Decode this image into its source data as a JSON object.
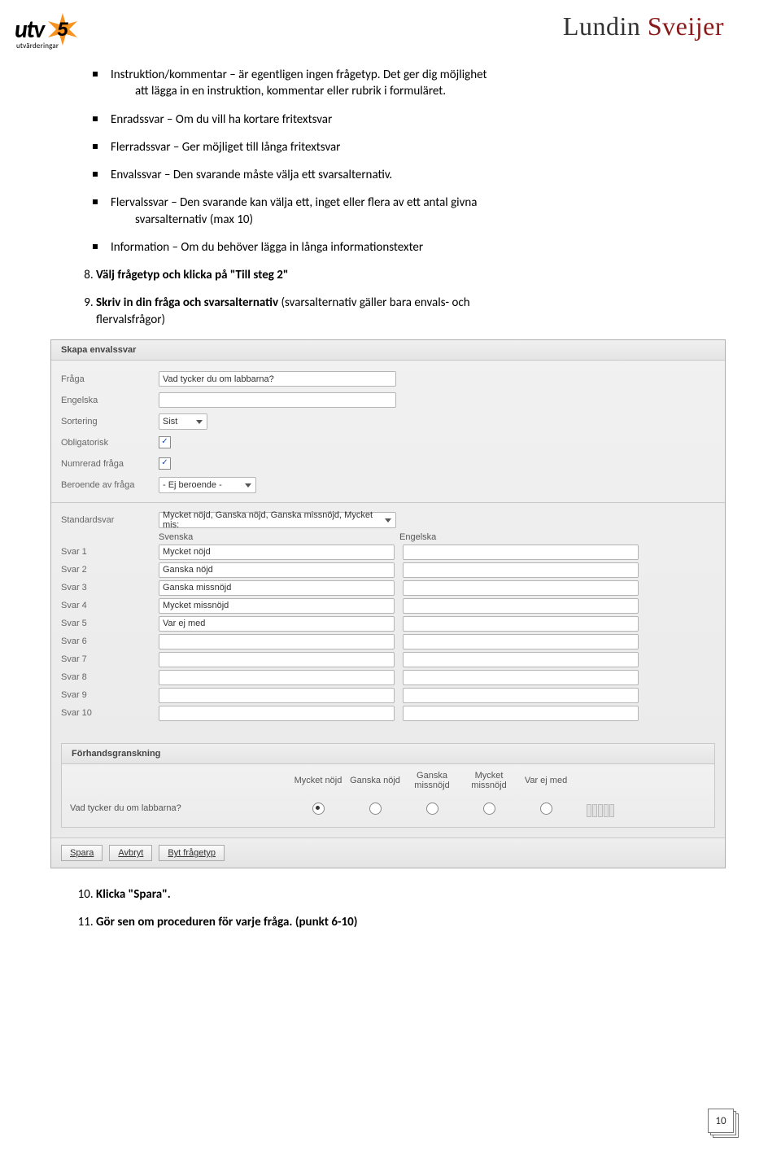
{
  "header": {
    "logo_text": "utv",
    "logo_sub": "utvärderingar",
    "brand_a": "Lundin ",
    "brand_b": "Sveijer"
  },
  "bullets": {
    "b1a": "Instruktion/kommentar – är egentligen ingen frågetyp. Det ger dig möjlighet",
    "b1b": "att lägga in en instruktion, kommentar eller rubrik i formuläret.",
    "b2": "Enradssvar – Om du vill ha kortare fritextsvar",
    "b3": "Flerradssvar – Ger möjliget till långa fritextsvar",
    "b4": "Envalssvar – Den svarande måste välja ett svarsalternativ.",
    "b5a": "Flervalssvar – Den svarande kan välja ett, inget eller flera av ett antal givna",
    "b5b": "svarsalternativ (max 10)",
    "b6": "Information – Om du behöver lägga in långa informationstexter"
  },
  "steps": {
    "s8_a": "Välj frågetyp och klicka på \"Till steg 2\"",
    "s9_a": "Skriv in din fråga och svarsalternativ",
    "s9_b": " (svarsalternativ gäller bara envals- och",
    "s9_c": "flervalsfrågor)",
    "s10_a": "Klicka \"Spara\".",
    "s11_a": "Gör sen om proceduren för varje fråga. (punkt 6-10)"
  },
  "form": {
    "panel_title": "Skapa envalssvar",
    "labels": {
      "fraga": "Fråga",
      "engelska": "Engelska",
      "sortering": "Sortering",
      "obligatorisk": "Obligatorisk",
      "numrerad": "Numrerad fråga",
      "beroende": "Beroende av fråga",
      "standardsvar": "Standardsvar",
      "svenska_col": "Svenska",
      "engelska_col": "Engelska",
      "svar": [
        "Svar 1",
        "Svar 2",
        "Svar 3",
        "Svar 4",
        "Svar 5",
        "Svar 6",
        "Svar 7",
        "Svar 8",
        "Svar 9",
        "Svar 10"
      ]
    },
    "values": {
      "fraga": "Vad tycker du om labbarna?",
      "engelska": "",
      "sortering": "Sist",
      "beroende": "- Ej beroende -",
      "standardsvar": "Mycket nöjd, Ganska nöjd, Ganska missnöjd, Mycket mis:",
      "svar_sv": [
        "Mycket nöjd",
        "Ganska nöjd",
        "Ganska missnöjd",
        "Mycket missnöjd",
        "Var ej med",
        "",
        "",
        "",
        "",
        ""
      ],
      "svar_en": [
        "",
        "",
        "",
        "",
        "",
        "",
        "",
        "",
        "",
        ""
      ]
    },
    "preview": {
      "title": "Förhandsgranskning",
      "headers": [
        "Mycket nöjd",
        "Ganska nöjd",
        "Ganska missnöjd",
        "Mycket missnöjd",
        "Var ej med"
      ],
      "question": "Vad tycker du om labbarna?"
    },
    "buttons": {
      "spara": "Spara",
      "avbryt": "Avbryt",
      "byt": "Byt frågetyp"
    }
  },
  "page_number": "10"
}
